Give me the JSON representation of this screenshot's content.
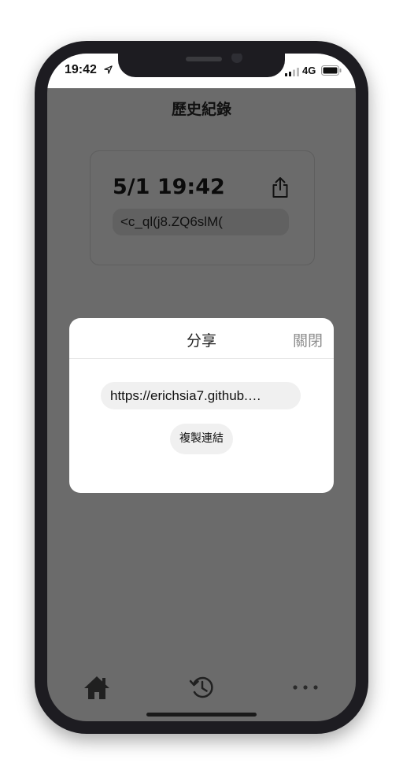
{
  "status_bar": {
    "time": "19:42",
    "network": "4G",
    "icons": [
      "location-icon",
      "signal-icon",
      "battery-icon"
    ]
  },
  "header": {
    "title": "歷史紀錄"
  },
  "history": {
    "items": [
      {
        "time": "5/1 19:42",
        "code": "<c_ql(j8.ZQ6slM(",
        "action_icon": "share-icon"
      }
    ]
  },
  "share_dialog": {
    "title": "分享",
    "close_label": "關閉",
    "url": "https://erichsia7.github.…",
    "copy_label": "複製連結"
  },
  "tab_bar": {
    "items": [
      {
        "name": "home",
        "icon": "home-icon"
      },
      {
        "name": "history",
        "icon": "history-icon"
      },
      {
        "name": "more",
        "icon": "more-icon"
      }
    ]
  },
  "colors": {
    "overlay_background": "#6b6b6b",
    "frame": "#1d1c21",
    "dialog_background": "#ffffff",
    "muted_text": "#8e8e8e"
  }
}
